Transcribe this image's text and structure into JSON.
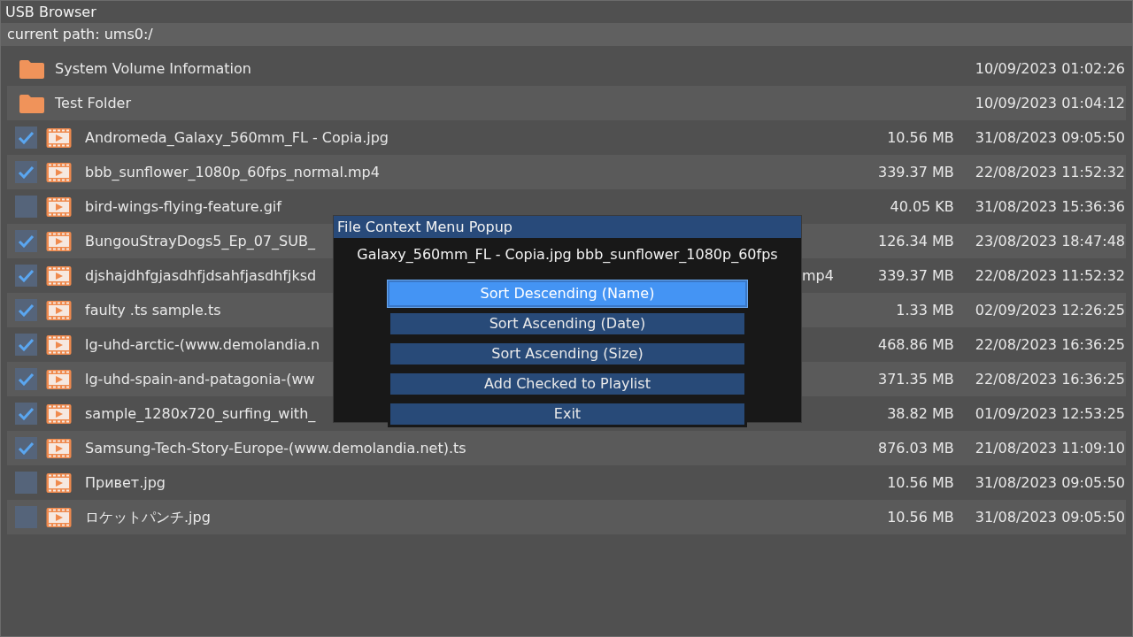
{
  "window": {
    "title": "USB Browser"
  },
  "path": "current path: ums0:/",
  "entries": [
    {
      "kind": "folder",
      "name": "System Volume Information",
      "date": "10/09/2023 01:02:26"
    },
    {
      "kind": "folder",
      "name": "Test Folder",
      "date": "10/09/2023 01:04:12"
    },
    {
      "kind": "file",
      "checked": true,
      "name": "Andromeda_Galaxy_560mm_FL - Copia.jpg",
      "size": "10.56 MB",
      "date": "31/08/2023 09:05:50"
    },
    {
      "kind": "file",
      "checked": true,
      "name": "bbb_sunflower_1080p_60fps_normal.mp4",
      "size": "339.37 MB",
      "date": "22/08/2023 11:52:32"
    },
    {
      "kind": "file",
      "checked": false,
      "name": "bird-wings-flying-feature.gif",
      "size": "40.05 KB",
      "date": "31/08/2023 15:36:36"
    },
    {
      "kind": "file",
      "checked": true,
      "name": "BungouStrayDogs5_Ep_07_SUB_",
      "size": "126.34 MB",
      "date": "23/08/2023 18:47:48"
    },
    {
      "kind": "file",
      "checked": true,
      "name": "djshajdhfgjasdhfjdsahfjasdhfjksd",
      "name_tail": "mp4",
      "size": "339.37 MB",
      "date": "22/08/2023 11:52:32"
    },
    {
      "kind": "file",
      "checked": true,
      "name": "faulty .ts sample.ts",
      "size": "1.33 MB",
      "date": "02/09/2023 12:26:25"
    },
    {
      "kind": "file",
      "checked": true,
      "name": "lg-uhd-arctic-(www.demolandia.n",
      "size": "468.86 MB",
      "date": "22/08/2023 16:36:25"
    },
    {
      "kind": "file",
      "checked": true,
      "name": "lg-uhd-spain-and-patagonia-(ww",
      "size": "371.35 MB",
      "date": "22/08/2023 16:36:25"
    },
    {
      "kind": "file",
      "checked": true,
      "name": "sample_1280x720_surfing_with_",
      "size": "38.82 MB",
      "date": "01/09/2023 12:53:25"
    },
    {
      "kind": "file",
      "checked": true,
      "name": "Samsung-Tech-Story-Europe-(www.demolandia.net).ts",
      "size": "876.03 MB",
      "date": "21/08/2023 11:09:10"
    },
    {
      "kind": "file",
      "checked": false,
      "name": "Привет.jpg",
      "size": "10.56 MB",
      "date": "31/08/2023 09:05:50"
    },
    {
      "kind": "file",
      "checked": false,
      "name": "ロケットパンチ.jpg",
      "size": "10.56 MB",
      "date": "31/08/2023 09:05:50"
    }
  ],
  "popup": {
    "title": "File Context Menu Popup",
    "selection": "Galaxy_560mm_FL - Copia.jpg bbb_sunflower_1080p_60fps",
    "items": [
      {
        "label": "Sort Descending (Name)",
        "selected": true
      },
      {
        "label": "Sort Ascending (Date)",
        "selected": false
      },
      {
        "label": "Sort Ascending (Size)",
        "selected": false
      },
      {
        "label": "Add Checked to Playlist",
        "selected": false
      },
      {
        "label": "Exit",
        "selected": false
      }
    ]
  }
}
